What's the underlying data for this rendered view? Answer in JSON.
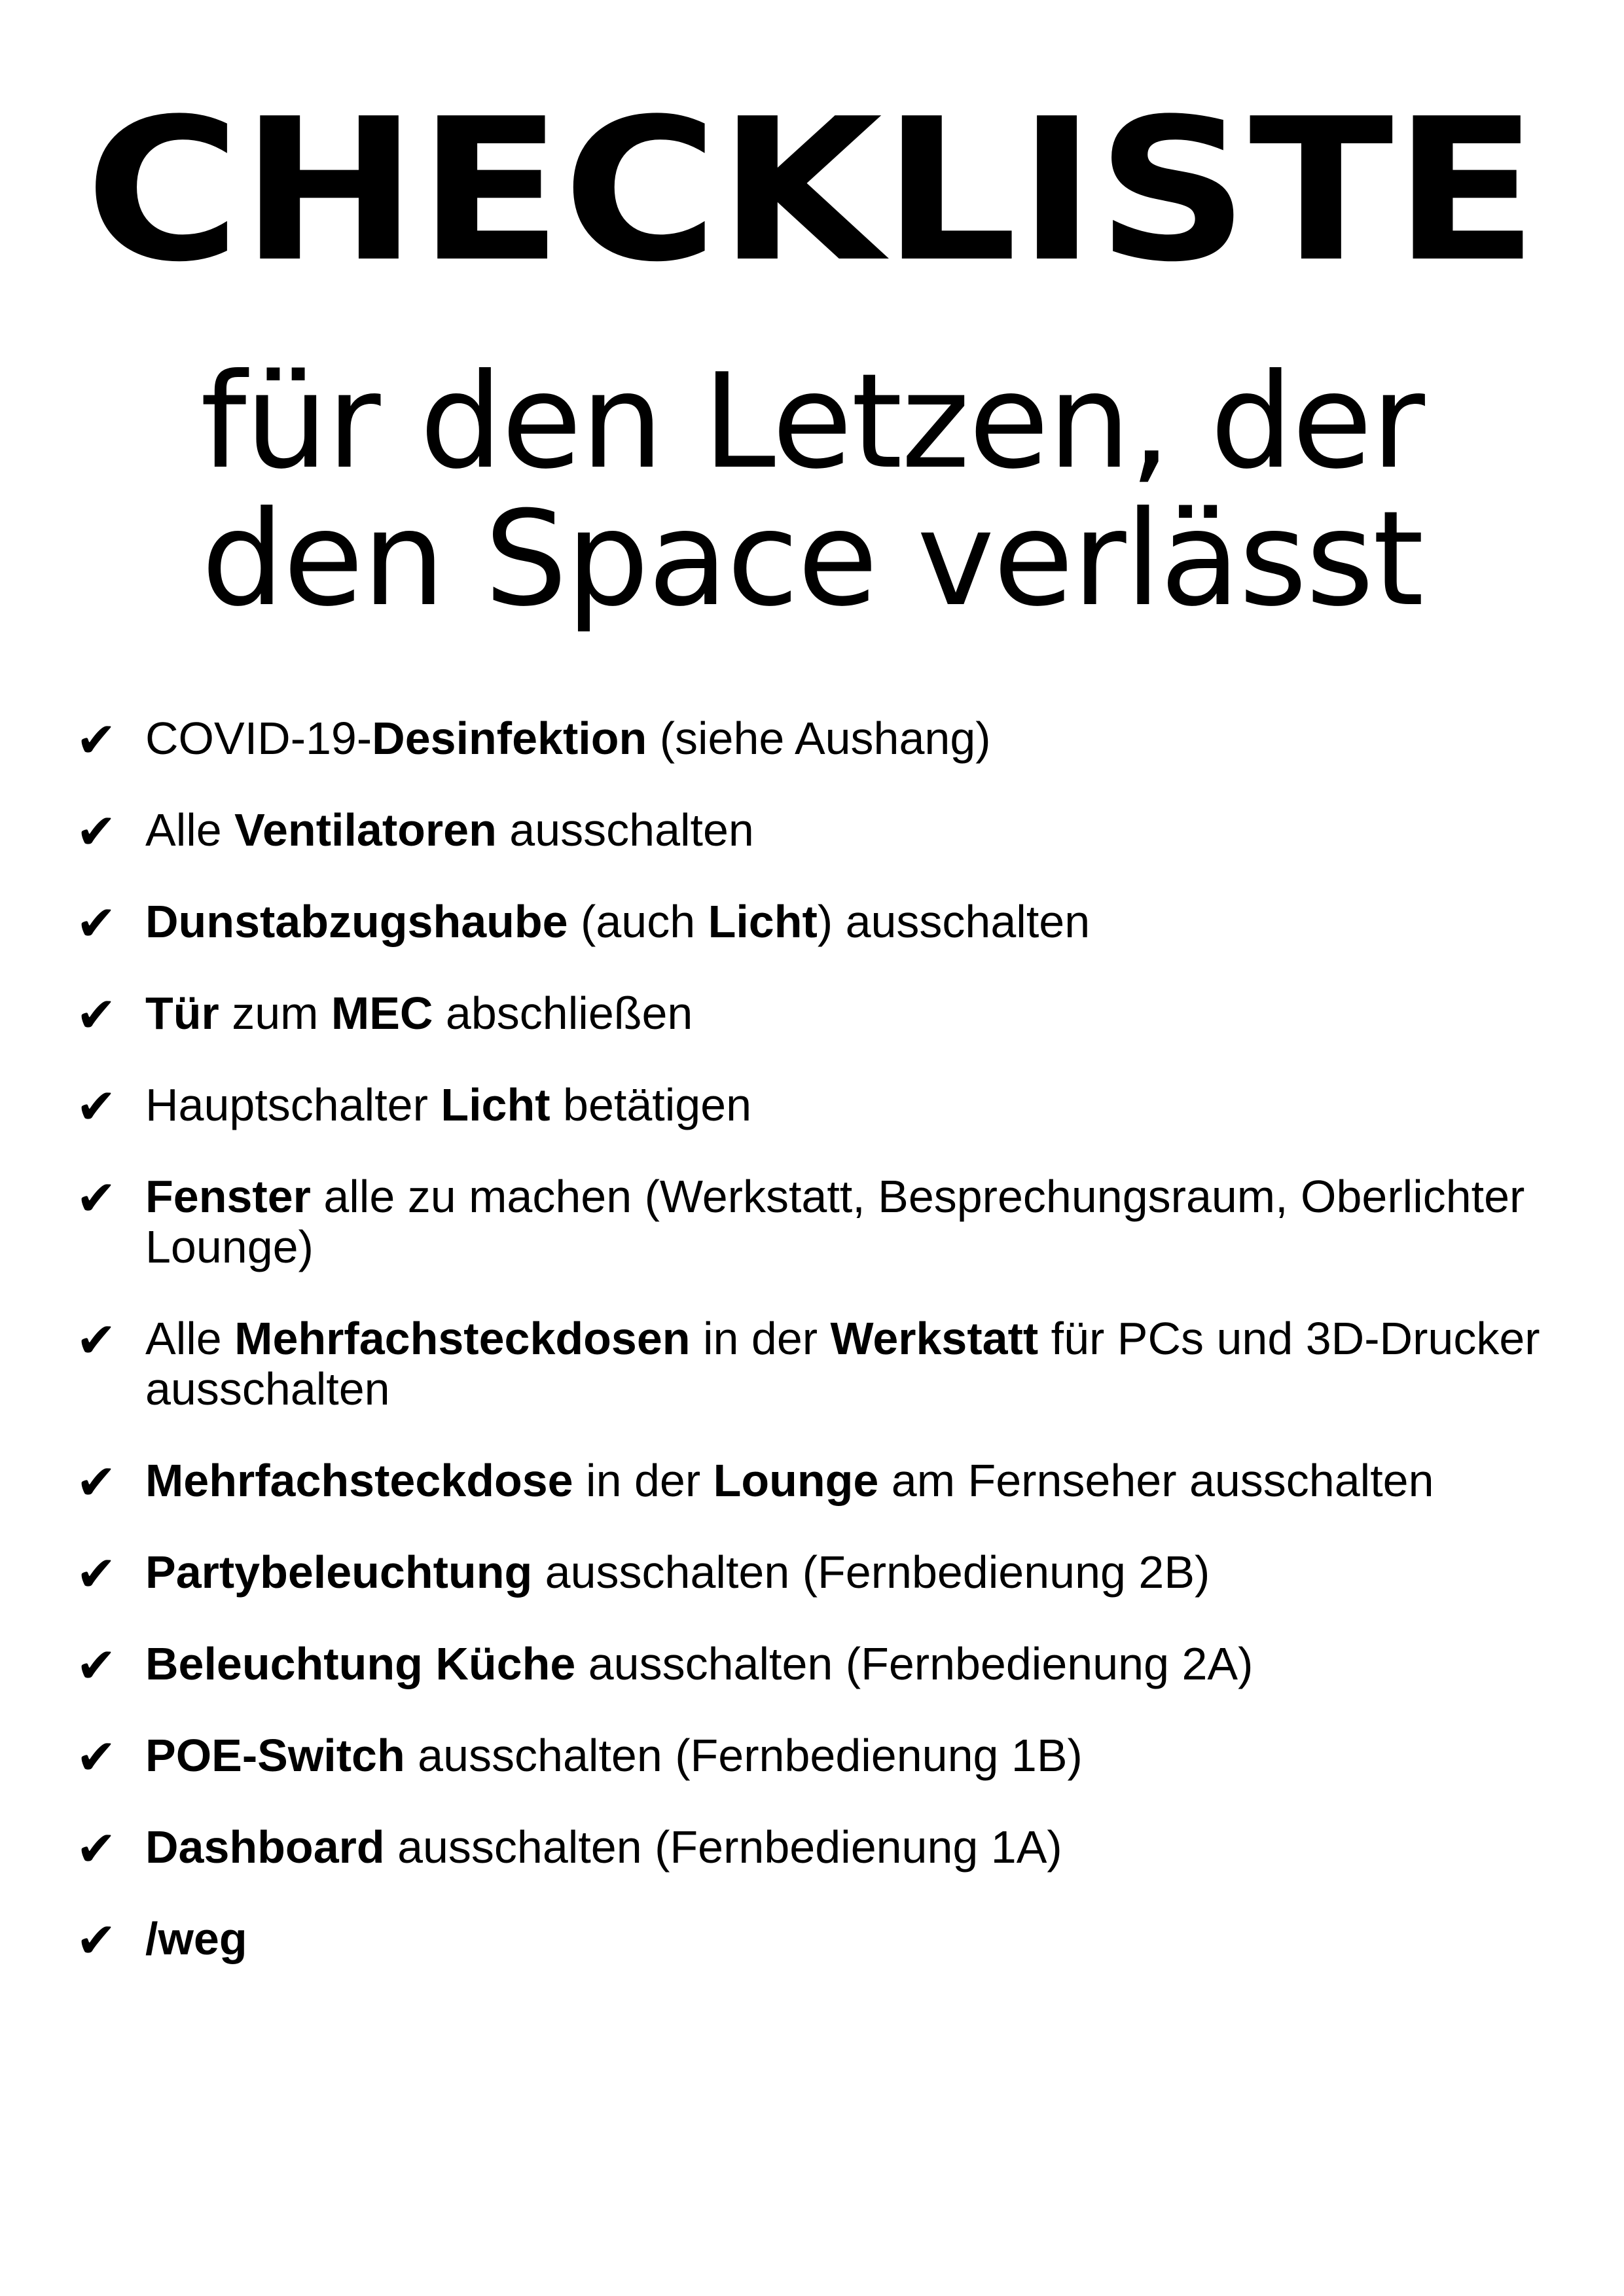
{
  "page": {
    "title": "CHECKLISTE",
    "subtitle_line1": "für den Letzen, der",
    "subtitle_line2": "den Space verlässt"
  },
  "check_icon": "check-mark-icon",
  "items": [
    [
      {
        "t": "COVID-19-",
        "b": false
      },
      {
        "t": "Desinfektion",
        "b": true
      },
      {
        "t": " (siehe Aushang)",
        "b": false
      }
    ],
    [
      {
        "t": "Alle ",
        "b": false
      },
      {
        "t": "Ventilatoren",
        "b": true
      },
      {
        "t": " ausschalten",
        "b": false
      }
    ],
    [
      {
        "t": "Dunstabzugshaube",
        "b": true
      },
      {
        "t": " (auch ",
        "b": false
      },
      {
        "t": "Licht",
        "b": true
      },
      {
        "t": ") ausschalten",
        "b": false
      }
    ],
    [
      {
        "t": "Tür",
        "b": true
      },
      {
        "t": " zum ",
        "b": false
      },
      {
        "t": "MEC",
        "b": true
      },
      {
        "t": " abschließen",
        "b": false
      }
    ],
    [
      {
        "t": "Hauptschalter ",
        "b": false
      },
      {
        "t": "Licht",
        "b": true
      },
      {
        "t": " betätigen",
        "b": false
      }
    ],
    [
      {
        "t": "Fenster",
        "b": true
      },
      {
        "t": " alle zu machen (Werkstatt, Besprechungsraum, Oberlichter Lounge)",
        "b": false
      }
    ],
    [
      {
        "t": "Alle ",
        "b": false
      },
      {
        "t": "Mehrfachsteckdosen",
        "b": true
      },
      {
        "t": " in der ",
        "b": false
      },
      {
        "t": "Werkstatt",
        "b": true
      },
      {
        "t": " für PCs und 3D-Drucker ausschalten",
        "b": false
      }
    ],
    [
      {
        "t": "Mehrfachsteckdose",
        "b": true
      },
      {
        "t": " in der ",
        "b": false
      },
      {
        "t": "Lounge",
        "b": true
      },
      {
        "t": " am Fernseher ausschalten",
        "b": false
      }
    ],
    [
      {
        "t": "Partybeleuchtung",
        "b": true
      },
      {
        "t": " ausschalten (Fernbedienung 2B)",
        "b": false
      }
    ],
    [
      {
        "t": "Beleuchtung Küche",
        "b": true
      },
      {
        "t": " ausschalten (Fernbedienung 2A)",
        "b": false
      }
    ],
    [
      {
        "t": "POE-Switch",
        "b": true
      },
      {
        "t": " ausschalten (Fernbedienung 1B)",
        "b": false
      }
    ],
    [
      {
        "t": "Dashboard",
        "b": true
      },
      {
        "t": " ausschalten (Fernbedienung 1A)",
        "b": false
      }
    ],
    [
      {
        "t": "/weg",
        "b": true
      }
    ]
  ]
}
